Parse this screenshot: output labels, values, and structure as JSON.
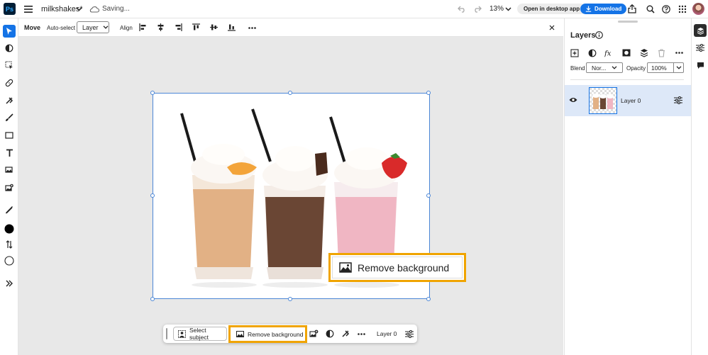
{
  "app": {
    "logo": "Ps"
  },
  "document": {
    "title": "milkshakes*",
    "status": "Saving..."
  },
  "header": {
    "zoom": "13%",
    "open_desktop_label": "Open in desktop app",
    "download_label": "Download"
  },
  "options_bar": {
    "tool_name": "Move",
    "auto_select_label": "Auto-select",
    "layer_dropdown_value": "Layer",
    "align_label": "Align"
  },
  "callout": {
    "label": "Remove background"
  },
  "taskbar": {
    "select_subject_label": "Select subject",
    "remove_background_label": "Remove background",
    "layer_label": "Layer 0"
  },
  "layers_panel": {
    "title": "Layers",
    "blend_label": "Blend",
    "blend_value": "Nor...",
    "opacity_label": "Opacity",
    "opacity_value": "100%",
    "layers": [
      {
        "name": "Layer 0",
        "visible": true,
        "selected": true
      }
    ]
  },
  "colors": {
    "accent": "#1473e6",
    "highlight": "#f0a400",
    "selected_row": "#dde8f8"
  }
}
